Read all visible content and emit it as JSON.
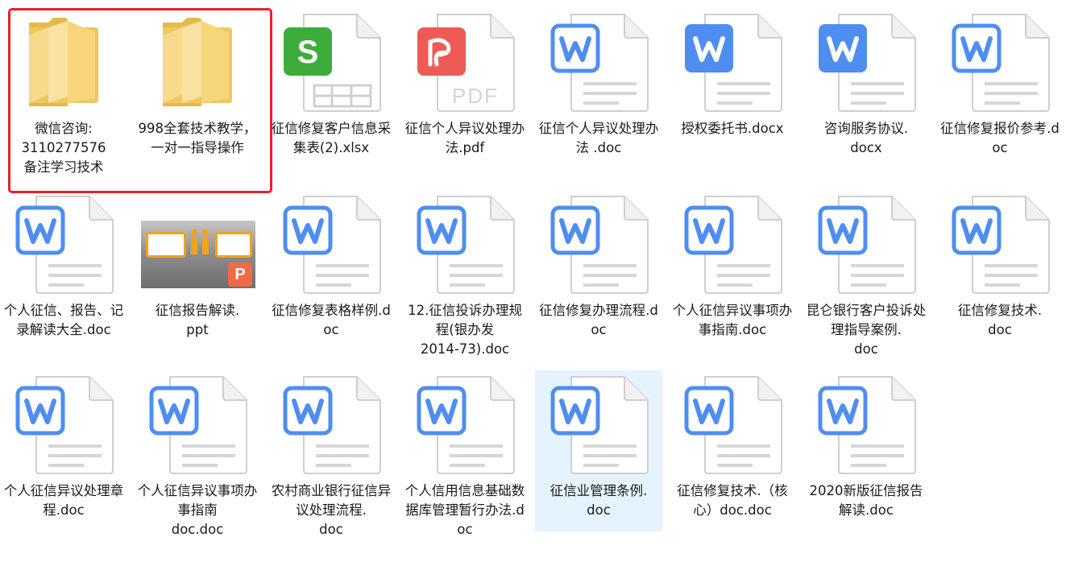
{
  "folder_view": {
    "items": [
      {
        "label": "微信咨询:\n3110277576\n备注学习技术",
        "type": "folder"
      },
      {
        "label": "998全套技术教学，一对一指导操作",
        "type": "folder"
      },
      {
        "label": "征信修复客户信息采集表(2).xlsx",
        "type": "xlsx"
      },
      {
        "label": "征信个人异议处理办法.pdf",
        "type": "pdf"
      },
      {
        "label": "征信个人异议处理办法 .doc",
        "type": "word"
      },
      {
        "label": "授权委托书.docx",
        "type": "word-solid"
      },
      {
        "label": "咨询服务协议.\ndocx",
        "type": "word-solid"
      },
      {
        "label": "征信修复报价参考.doc",
        "type": "word"
      },
      {
        "label": "个人征信、报告、记录解读大全.doc",
        "type": "word"
      },
      {
        "label": "征信报告解读.\nppt",
        "type": "ppt"
      },
      {
        "label": "征信修复表格样例.doc",
        "type": "word"
      },
      {
        "label": "12.征信投诉办理规程(银办发\n2014-73).doc",
        "type": "word"
      },
      {
        "label": "征信修复办理流程.doc",
        "type": "word"
      },
      {
        "label": "个人征信异议事项办事指南.doc",
        "type": "word"
      },
      {
        "label": "昆仑银行客户投诉处理指导案例.\ndoc",
        "type": "word"
      },
      {
        "label": "征信修复技术.\ndoc",
        "type": "word"
      },
      {
        "label": "个人征信异议处理章程.doc",
        "type": "word"
      },
      {
        "label": "个人征信异议事项办事指南\ndoc.doc",
        "type": "word"
      },
      {
        "label": "农村商业银行征信异议处理流程.\ndoc",
        "type": "word"
      },
      {
        "label": "个人信用信息基础数据库管理暂行办法.doc",
        "type": "word"
      },
      {
        "label": "征信业管理条例.\ndoc",
        "type": "word",
        "selected": true
      },
      {
        "label": "征信修复技术.（核心）doc.doc",
        "type": "word"
      },
      {
        "label": "2020新版征信报告解读.doc",
        "type": "word"
      }
    ]
  },
  "colors": {
    "word_blue": "#4f8ef0",
    "excel_green": "#3cad3a",
    "pdf_red": "#ee5a55",
    "ppt_orange": "#ef6a45",
    "folder_yellow": "#f7d57a",
    "highlight_red": "#e8202a",
    "selection": "#e5f3ff"
  },
  "icons": {
    "folder": "folder-icon",
    "xlsx": "excel-file-icon",
    "pdf": "pdf-file-icon",
    "word": "word-file-icon",
    "word-solid": "word-file-icon",
    "ppt": "ppt-file-icon"
  },
  "ppt_badge_letter": "P",
  "pdf_text": "PDF",
  "excel_letter": "S"
}
